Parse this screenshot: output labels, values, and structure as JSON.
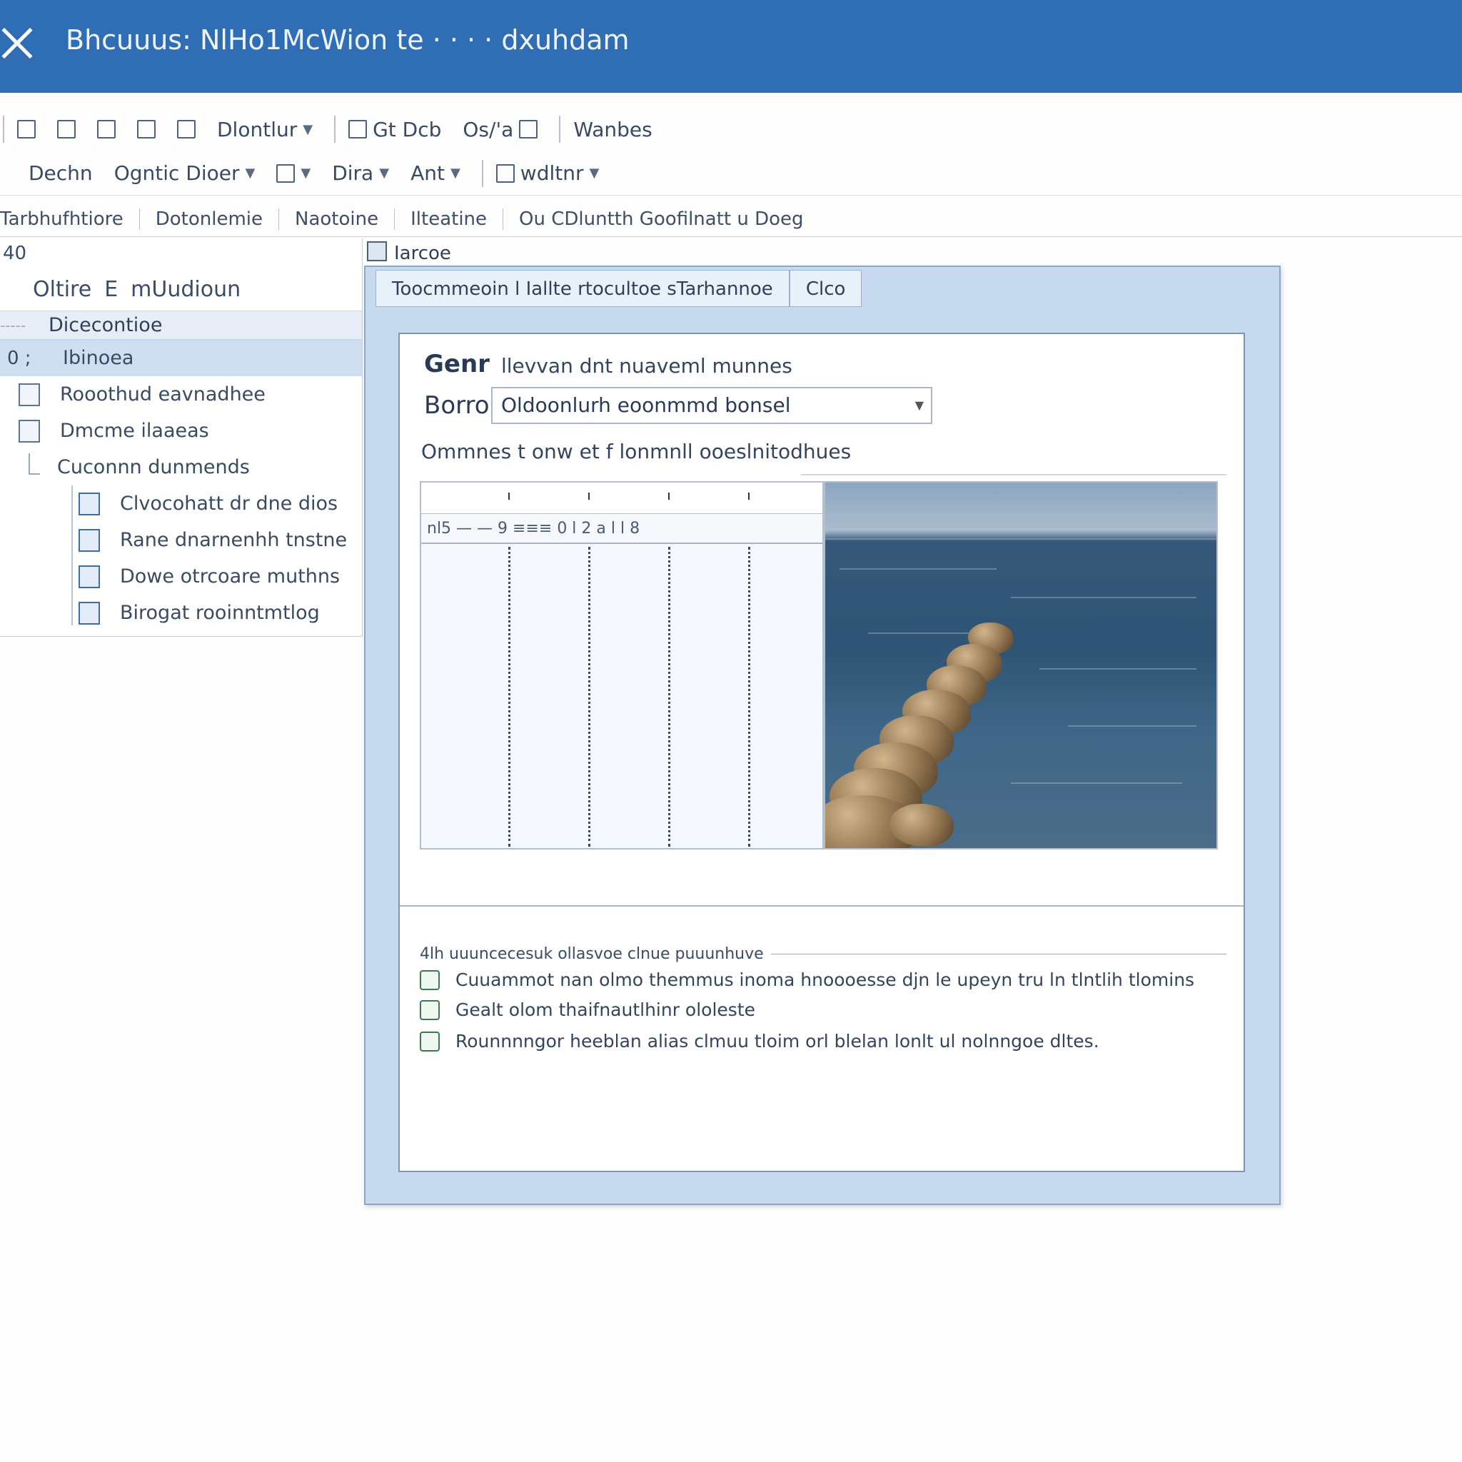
{
  "window": {
    "title": "Bhcuuus: NlHo1McWion te · · · · dxuhdam"
  },
  "ribbon": {
    "row1": [
      "Dlontlur",
      "Gt Dcb",
      "Os/'a",
      "Wanbes"
    ],
    "row2": [
      "Dechn",
      "Ogntic Dioer",
      "Dira",
      "Ant",
      "wdltnr"
    ],
    "tabs": [
      "Tarbhufhtiore",
      "Dotonlemie",
      "Naotoine",
      "Ilteatine",
      "Ou CDluntth Goofilnatt u Doeg"
    ]
  },
  "sidebar": {
    "top_label": "40",
    "tool_labels": [
      "Oltire",
      "E",
      "mUudioun"
    ],
    "section_label": "Dicecontioe",
    "selected_num": "0 ;",
    "items": [
      {
        "label": "Ibinoea",
        "selected": true
      },
      {
        "label": "Rooothud eavnadhee",
        "icon": "doc-edit-icon"
      },
      {
        "label": "Dmcme ilaaeas",
        "icon": "doc-grid-icon"
      },
      {
        "label": "Cuconnn dunmends",
        "group": true
      }
    ],
    "children": [
      {
        "label": "Clvocohatt dr dne dios",
        "icon": "table-icon"
      },
      {
        "label": "Rane dnarnenhh tnstne",
        "icon": "doc-blue-icon"
      },
      {
        "label": "Dowe otrcoare muthns",
        "icon": "layout-icon"
      },
      {
        "label": "Birogat rooinntmtlog",
        "icon": "book-icon"
      }
    ]
  },
  "panel": {
    "header_label": "Iarcoe"
  },
  "dialog": {
    "tabs": [
      "Toocmmeoin l Iallte rtocultoe sTarhannoe",
      "Clco"
    ],
    "general_label": "Genr",
    "general_desc": "llevvan dnt nuaveml munnes",
    "form_label": "Borro",
    "field_value": "Oldoonlurh eoonmmd bonsel",
    "section_label": "Ommnes t onw et f lonmnll ooeslnitodhues",
    "grid_row_text": "nl5 — — 9  ≡≡≡  0 l 2  a l l 8",
    "info": {
      "heading": "4lh uuuncecesuk ollasvoe clnue puuunhuve",
      "rows": [
        "Cuuammot nan olmo themmus inoma hnoooesse djn le upeyn tru ln tlntlih tlomins",
        "Gealt olom thaifnautlhinr ololeste",
        "Rounnnngor heeblan alias clmuu tloim orl blelan lonlt ul nolnngoe dltes."
      ]
    }
  }
}
